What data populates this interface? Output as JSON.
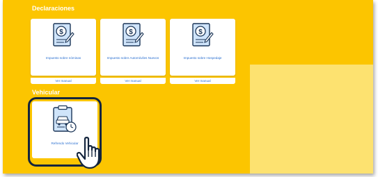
{
  "sections": {
    "declaraciones": "Declaraciones",
    "vehicular": "Vehicular"
  },
  "declaraciones_cards": [
    {
      "title": "Impuesto sobre nóminas",
      "link": "Ver manual"
    },
    {
      "title": "Impuesto sobre Automóviles Nuevos",
      "link": "Ver manual"
    },
    {
      "title": "Impuesto sobre Hospedaje",
      "link": "Ver manual"
    }
  ],
  "vehicular_card": {
    "title": "Refrendo Vehicular"
  },
  "icons": {
    "declaration": "document-dollar-pencil-icon",
    "vehicle": "clipboard-car-clock-icon",
    "cursor": "hand-pointer-cursor-icon"
  },
  "colors": {
    "background": "#fcc500",
    "panel": "#fde270",
    "accent": "#2a6fd0",
    "highlight_border": "#14253d"
  }
}
